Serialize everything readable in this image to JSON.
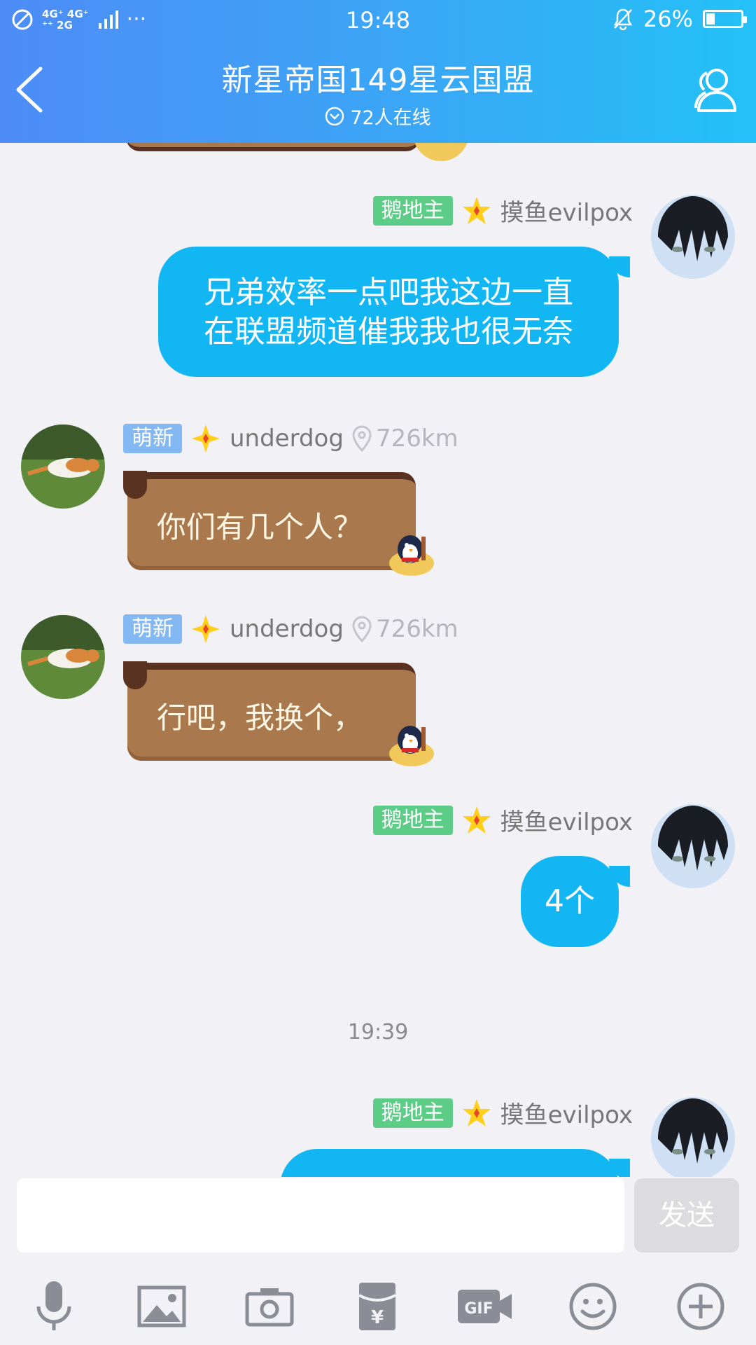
{
  "status_bar": {
    "network_top": "4G⁺ 4G⁺",
    "network_bottom": "⁺⁺ 2G",
    "dots": "···",
    "time": "19:48",
    "battery": "26%",
    "battery_level": 0.26
  },
  "header": {
    "title": "新星帝国149星云国盟",
    "online": "72人在线"
  },
  "messages": [
    {
      "side": "right",
      "badge": "鹅地主",
      "name": "摸鱼evilpox",
      "text_lines": [
        "兄弟效率一点吧我这边一直",
        "在联盟频道催我我也很无奈"
      ]
    },
    {
      "side": "left",
      "badge": "萌新",
      "name": "underdog",
      "distance": "726km",
      "text": "你们有几个人？"
    },
    {
      "side": "left",
      "badge": "萌新",
      "name": "underdog",
      "distance": "726km",
      "text": "行吧，我换个，"
    },
    {
      "side": "right",
      "badge": "鹅地主",
      "name": "摸鱼evilpox",
      "text": "4个"
    },
    {
      "timestamp": "19:39"
    },
    {
      "side": "right",
      "badge": "鹅地主",
      "name": "摸鱼evilpox",
      "text": ""
    }
  ],
  "input": {
    "placeholder": "",
    "send_label": "发送"
  },
  "toolbar": [
    "microphone-icon",
    "image-icon",
    "camera-icon",
    "red-packet-icon",
    "gif-icon",
    "emoji-icon",
    "plus-icon"
  ],
  "colors": {
    "header_start": "#4e8cf7",
    "header_end": "#23c1f7",
    "bubble_blue": "#12b6f2",
    "bubble_brown": "#a9784c",
    "badge_green": "#5ccc87",
    "badge_blue": "#84b8f2"
  }
}
